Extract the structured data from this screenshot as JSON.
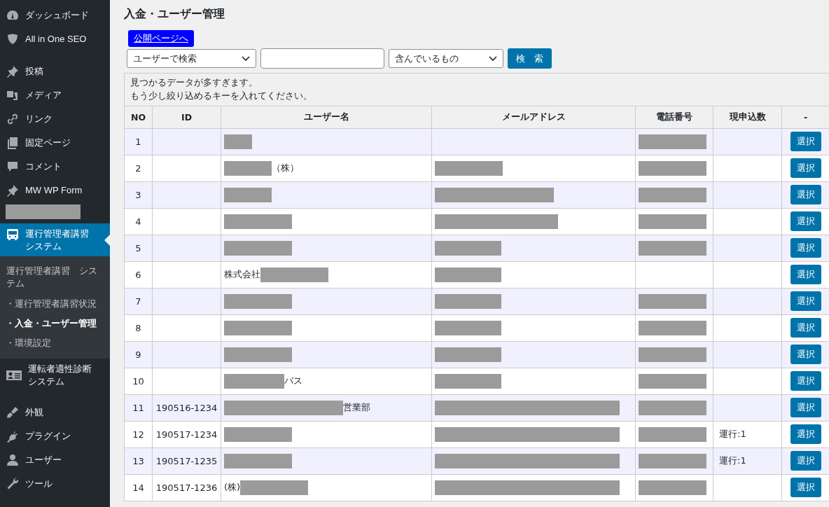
{
  "sidebar": {
    "sections": [
      [
        {
          "kind": "menu",
          "label": "ダッシュボード",
          "selected": false
        },
        {
          "kind": "menu",
          "label": "All in One SEO",
          "selected": false
        }
      ],
      [
        {
          "kind": "menu",
          "label": "投稿",
          "selected": false
        },
        {
          "kind": "menu",
          "label": "メディア",
          "selected": false
        },
        {
          "kind": "menu",
          "label": "リンク",
          "selected": false
        },
        {
          "kind": "menu",
          "label": "固定ページ",
          "selected": false
        },
        {
          "kind": "menu",
          "label": "コメント",
          "selected": false
        },
        {
          "kind": "menu",
          "label": "MW WP Form",
          "selected": false
        },
        {
          "kind": "redacted"
        },
        {
          "kind": "menu",
          "label": "運行管理者講習システム",
          "selected": true,
          "submenu": {
            "title": "運行管理者講習　システム",
            "items": [
              {
                "label": "・運行管理者講習状況",
                "selected": false
              },
              {
                "label": "・入金・ユーザー管理",
                "selected": true
              },
              {
                "label": "・環境設定",
                "selected": false
              }
            ]
          }
        },
        {
          "kind": "menu",
          "label": "運転者適性診断システム",
          "selected": false
        }
      ],
      [
        {
          "kind": "menu",
          "label": "外観",
          "selected": false
        },
        {
          "kind": "menu",
          "label": "プラグイン",
          "selected": false
        },
        {
          "kind": "menu",
          "label": "ユーザー",
          "selected": false
        },
        {
          "kind": "menu",
          "label": "ツール",
          "selected": false
        }
      ]
    ]
  },
  "page": {
    "title": "入金・ユーザー管理",
    "public_link": "公開ページへ"
  },
  "search": {
    "field_select": "ユーザーで検索",
    "match_select": "含んでいるもの",
    "button": "検　索"
  },
  "message": [
    "見つかるデータが多すぎます。",
    "もう少し絞り込めるキーを入れてください。"
  ],
  "table": {
    "columns": [
      "NO",
      "ID",
      "ユーザー名",
      "メールアドレス",
      "電話番号",
      "現申込数",
      "-"
    ],
    "rows": [
      {
        "no": "1",
        "name": {
          "redacted": true
        },
        "phone": {
          "redacted": true
        },
        "button": "選択"
      },
      {
        "no": "2",
        "name": {
          "redacted": true,
          "after": "（株）"
        },
        "email": {
          "redacted": true
        },
        "phone": {
          "redacted": true
        },
        "button": "選択"
      },
      {
        "no": "3",
        "name": {
          "redacted": true
        },
        "email": {
          "redacted": true
        },
        "phone": {
          "redacted": true
        },
        "button": "選択"
      },
      {
        "no": "4",
        "name": {
          "redacted": true
        },
        "email": {
          "redacted": true
        },
        "phone": {
          "redacted": true
        },
        "button": "選択"
      },
      {
        "no": "5",
        "name": {
          "redacted": true
        },
        "email": {
          "redacted": true
        },
        "phone": {
          "redacted": true
        },
        "button": "選択"
      },
      {
        "no": "6",
        "name": {
          "before": "株式会社",
          "redacted": true
        },
        "email": {
          "redacted": true
        },
        "button": "選択"
      },
      {
        "no": "7",
        "name": {
          "redacted": true
        },
        "email": {
          "redacted": true
        },
        "phone": {
          "redacted": true
        },
        "button": "選択"
      },
      {
        "no": "8",
        "name": {
          "redacted": true
        },
        "email": {
          "redacted": true
        },
        "phone": {
          "redacted": true
        },
        "button": "選択"
      },
      {
        "no": "9",
        "name": {
          "redacted": true
        },
        "email": {
          "redacted": true
        },
        "phone": {
          "redacted": true
        },
        "button": "選択"
      },
      {
        "no": "10",
        "name": {
          "redacted": true,
          "after": "バス"
        },
        "email": {
          "redacted": true
        },
        "phone": {
          "redacted": true
        },
        "button": "選択"
      },
      {
        "no": "11",
        "id": "190516-1234",
        "name": {
          "redacted": true,
          "after": "営業部"
        },
        "email": {
          "redacted": true
        },
        "phone": {
          "redacted": true
        },
        "button": "選択"
      },
      {
        "no": "12",
        "id": "190517-1234",
        "name": {
          "redacted": true
        },
        "email": {
          "redacted": true
        },
        "phone": {
          "redacted": true
        },
        "count": "運行:1",
        "button": "選択"
      },
      {
        "no": "13",
        "id": "190517-1235",
        "name": {
          "redacted": true
        },
        "email": {
          "redacted": true
        },
        "phone": {
          "redacted": true
        },
        "count": "運行:1",
        "button": "選択"
      },
      {
        "no": "14",
        "id": "190517-1236",
        "name": {
          "before": "(株)",
          "redacted": true
        },
        "email": {
          "redacted": true
        },
        "phone": {
          "redacted": true
        },
        "button": "選択"
      }
    ]
  }
}
